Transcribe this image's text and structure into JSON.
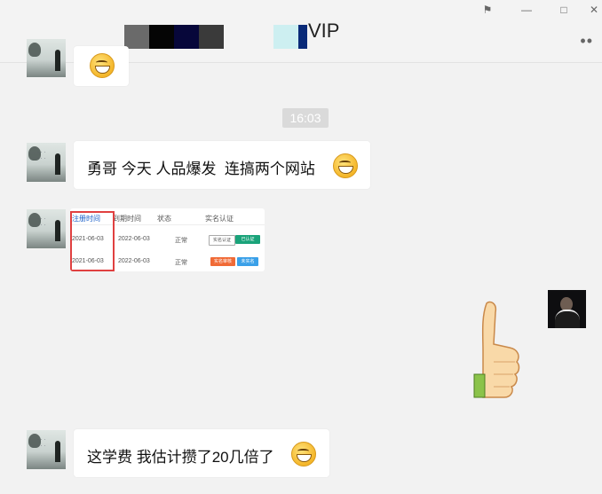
{
  "window": {
    "controls": [
      "pin",
      "minimize",
      "maximize",
      "close"
    ],
    "title": "VIP",
    "more_icon": "more-dots-icon"
  },
  "timestamp": "16:03",
  "messages": [
    {
      "type": "emoji",
      "sender": "other"
    },
    {
      "type": "text",
      "sender": "other",
      "text": "勇哥 今天 人品爆发  连搞两个网站"
    },
    {
      "type": "image",
      "sender": "other",
      "table": {
        "headers": [
          "注册时间",
          "到期时间",
          "状态",
          "实名认证"
        ],
        "rows": [
          {
            "reg": "2021-06-03",
            "exp": "2022-06-03",
            "status": "正常",
            "actions": [
              "实名认证",
              "已认证"
            ]
          },
          {
            "reg": "2021-06-03",
            "exp": "2022-06-03",
            "status": "正常",
            "actions": [
              "实名审核",
              "未实名"
            ]
          }
        ]
      }
    },
    {
      "type": "sticker",
      "sender": "me",
      "sticker": "thumbs-up"
    },
    {
      "type": "text",
      "sender": "other",
      "text": "这学费 我估计攒了20几倍了"
    }
  ],
  "colors": {
    "background": "#f2f2f2",
    "bubble": "#ffffff",
    "red_box": "#e04040",
    "btn_green": "#1aa37a",
    "btn_orange": "#f06a36",
    "btn_blue": "#3aa0e8"
  }
}
